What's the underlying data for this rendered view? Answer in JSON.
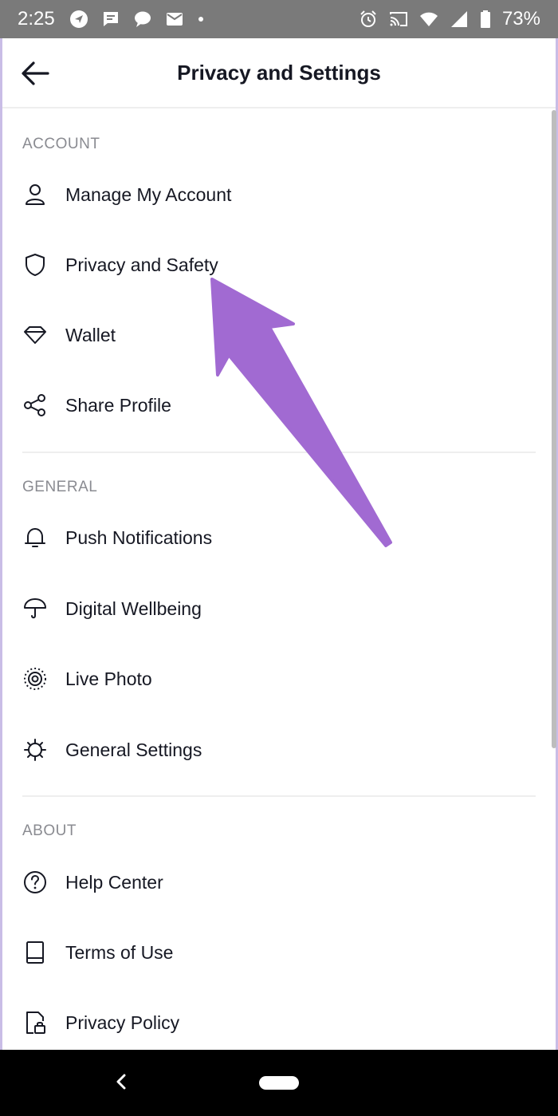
{
  "status_bar": {
    "time": "2:25",
    "battery": "73%",
    "left_icons": [
      "navigation-icon",
      "message-icon",
      "chat-icon",
      "mail-icon",
      "dot-icon"
    ],
    "right_icons": [
      "alarm-icon",
      "cast-icon",
      "wifi-icon",
      "signal-icon",
      "battery-icon"
    ]
  },
  "header": {
    "title": "Privacy and Settings",
    "back_icon": "arrow-left-icon"
  },
  "sections": {
    "account": {
      "title": "ACCOUNT",
      "items": [
        {
          "label": "Manage My Account",
          "icon": "person-icon"
        },
        {
          "label": "Privacy and Safety",
          "icon": "shield-icon"
        },
        {
          "label": "Wallet",
          "icon": "diamond-icon"
        },
        {
          "label": "Share Profile",
          "icon": "share-icon"
        }
      ]
    },
    "general": {
      "title": "GENERAL",
      "items": [
        {
          "label": "Push Notifications",
          "icon": "bell-icon"
        },
        {
          "label": "Digital Wellbeing",
          "icon": "umbrella-icon"
        },
        {
          "label": "Live Photo",
          "icon": "live-photo-icon"
        },
        {
          "label": "General Settings",
          "icon": "gear-icon"
        }
      ]
    },
    "about": {
      "title": "ABOUT",
      "items": [
        {
          "label": "Help Center",
          "icon": "help-icon"
        },
        {
          "label": "Terms of Use",
          "icon": "book-icon"
        },
        {
          "label": "Privacy Policy",
          "icon": "lock-document-icon"
        }
      ]
    }
  },
  "annotation": {
    "color": "#a16ad2"
  },
  "colors": {
    "status_bar": "#7a7a7a",
    "text_primary": "#161823",
    "text_section": "#8a8b91",
    "divider": "#eeeeee",
    "edge": "#c9bde6"
  }
}
